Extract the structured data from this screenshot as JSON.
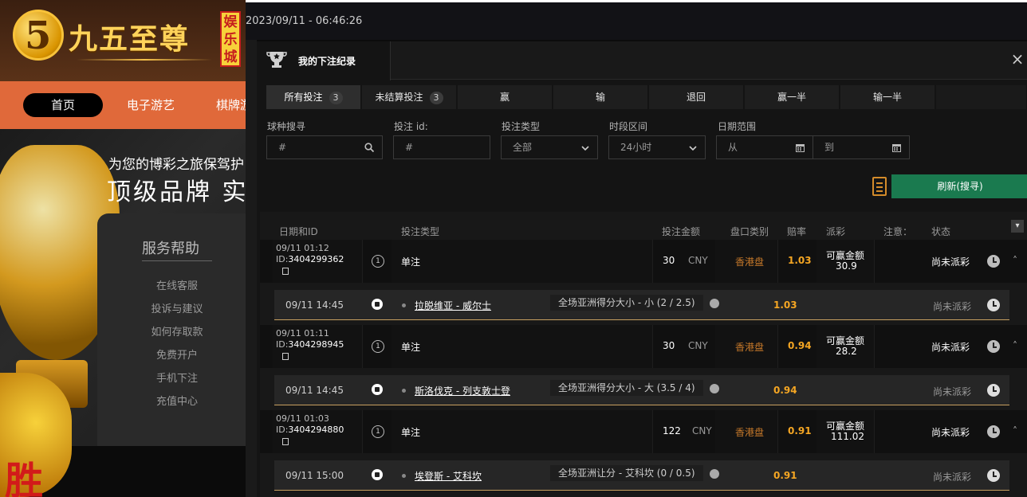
{
  "site": {
    "logo_text": "九五至尊",
    "logo_badge": "娱乐城",
    "nav": [
      "首页",
      "电子游艺",
      "棋牌游"
    ],
    "banner_sub": "为您的博彩之旅保驾护",
    "banner_title": "顶级品牌 实",
    "help_title": "服务帮助",
    "help_links": [
      "在线客服",
      "投诉与建议",
      "如何存取款",
      "免费开户",
      "手机下注",
      "充值中心"
    ],
    "win_char": "胜",
    "datetime": "2023/09/11 - 06:46:26"
  },
  "modal": {
    "title": "我的下注纪录",
    "close": "×",
    "tabs": [
      {
        "label": "所有投注",
        "count": "3"
      },
      {
        "label": "未结算投注",
        "count": "3"
      },
      {
        "label": "赢"
      },
      {
        "label": "输"
      },
      {
        "label": "退回"
      },
      {
        "label": "赢一半"
      },
      {
        "label": "输一半"
      }
    ],
    "filters": {
      "sport_label": "球种搜寻",
      "sport_value": "#",
      "betid_label": "投注 id:",
      "betid_value": "#",
      "bettype_label": "投注类型",
      "bettype_value": "全部",
      "period_label": "时段区间",
      "period_value": "24小时",
      "date_label": "日期范围",
      "date_from": "从",
      "date_to": "到"
    },
    "refresh": "刷新(搜寻)",
    "columns": [
      "日期和ID",
      "投注类型",
      "投注金额",
      "盘口类别",
      "赔率",
      "派彩",
      "注意：",
      "状态"
    ],
    "bets": [
      {
        "date": "09/11 01:12",
        "id_prefix": "ID:",
        "id": "3404299362",
        "count": "1",
        "type": "单注",
        "amount": "30",
        "currency": "CNY",
        "odds_type": "香港盘",
        "odds": "1.03",
        "payout_label": "可赢金额",
        "payout": "30.9",
        "status": "尚未派彩",
        "sub": {
          "date": "09/11 14:45",
          "match": "拉脱维亚 - 威尔士",
          "market": "全场亚洲得分大小 - 小 (2 / 2.5)",
          "odds": "1.03",
          "status": "尚未派彩"
        }
      },
      {
        "date": "09/11 01:11",
        "id_prefix": "ID:",
        "id": "3404298945",
        "count": "1",
        "type": "单注",
        "amount": "30",
        "currency": "CNY",
        "odds_type": "香港盘",
        "odds": "0.94",
        "payout_label": "可赢金额",
        "payout": "28.2",
        "status": "尚未派彩",
        "sub": {
          "date": "09/11 14:45",
          "match": "斯洛伐克 - 列支敦士登",
          "market": "全场亚洲得分大小 - 大 (3.5 / 4)",
          "odds": "0.94",
          "status": "尚未派彩"
        }
      },
      {
        "date": "09/11 01:03",
        "id_prefix": "ID:",
        "id": "3404294880",
        "count": "1",
        "type": "单注",
        "amount": "122",
        "currency": "CNY",
        "odds_type": "香港盘",
        "odds": "0.91",
        "payout_label": "可赢金额",
        "payout": "111.02",
        "status": "尚未派彩",
        "sub": {
          "date": "09/11 15:00",
          "match": "埃登斯 - 艾科坎",
          "market": "全场亚洲让分 - 艾科坎 (0 / 0.5)",
          "odds": "0.91",
          "status": "尚未派彩"
        }
      }
    ]
  }
}
